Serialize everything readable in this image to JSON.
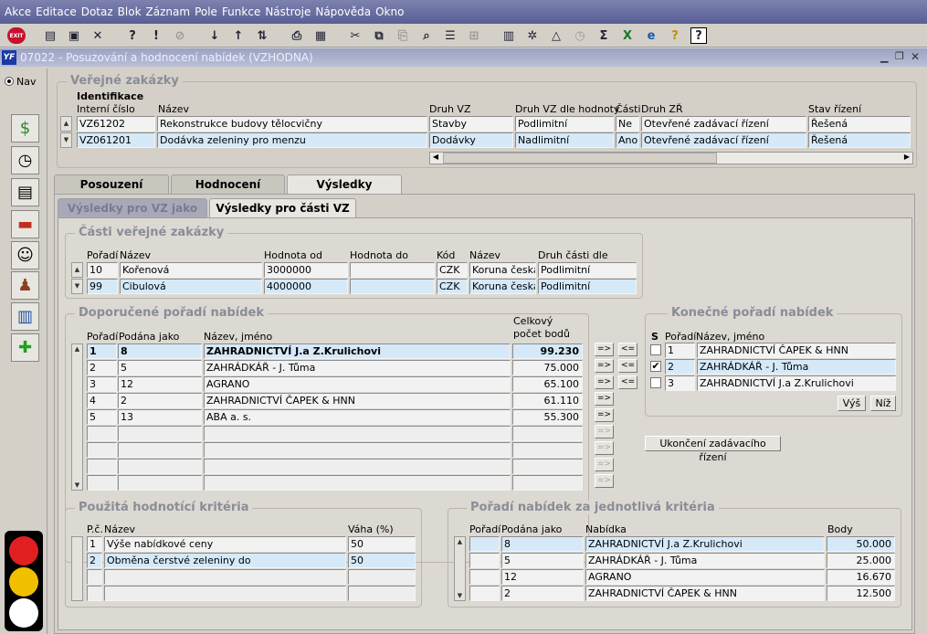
{
  "menu": [
    "Akce",
    "Editace",
    "Dotaz",
    "Blok",
    "Záznam",
    "Pole",
    "Funkce",
    "Nástroje",
    "Nápověda",
    "Okno"
  ],
  "toolbar": {
    "exit_label": "EXIT"
  },
  "window": {
    "title": "07022 - Posuzování a hodnocení nabídek (VZHODNA)",
    "app_icon": "YF"
  },
  "nav": {
    "label": "Nav"
  },
  "public": {
    "title": "Veřejné zakázky",
    "subtitle": "Identifikace",
    "headers": [
      "Interní číslo",
      "Název",
      "Druh VZ",
      "Druh VZ dle hodnoty",
      "Části",
      "Druh ZŘ",
      "Stav řízení"
    ],
    "rows": [
      [
        "VZ61202",
        "Rekonstrukce budovy tělocvičny",
        "Stavby",
        "Podlimitní",
        "Ne",
        "Otevřené zadávací řízení",
        "Řešená"
      ],
      [
        "VZ061201",
        "Dodávka zeleniny pro menzu",
        "Dodávky",
        "Nadlimitní",
        "Ano",
        "Otevřené zadávací řízení",
        "Řešená"
      ]
    ]
  },
  "tabs": [
    "Posouzení",
    "Hodnocení nabídek",
    "Výsledky hodnocení"
  ],
  "subtabs": [
    "Výsledky pro VZ jako celek",
    "Výsledky pro části VZ"
  ],
  "parts": {
    "title": "Části veřejné zakázky",
    "headers": [
      "Pořadí",
      "Název",
      "Hodnota od",
      "Hodnota do",
      "Kód",
      "Název",
      "Druh části dle hodnoty"
    ],
    "rows": [
      [
        "10",
        "Kořenová",
        "3000000",
        "",
        "CZK",
        "Koruna česká",
        "Podlimitní"
      ],
      [
        "99",
        "Cibulová",
        "4000000",
        "",
        "CZK",
        "Koruna česká",
        "Podlimitní"
      ]
    ]
  },
  "recommended": {
    "title": "Doporučené pořadí nabídek",
    "headers": [
      "Pořadí",
      "Podána jako",
      "Název, jméno",
      "Celkový",
      "počet bodů"
    ],
    "rows": [
      [
        "1",
        "8",
        "ZAHRADNICTVÍ J.a Z.Krulichovi",
        "99.230"
      ],
      [
        "2",
        "5",
        "ZAHRÁDKÁŘ - J. Tůma",
        "75.000"
      ],
      [
        "3",
        "12",
        "AGRANO",
        "65.100"
      ],
      [
        "4",
        "2",
        "ZAHRADNICTVÍ ČAPEK & HNN",
        "61.110"
      ],
      [
        "5",
        "13",
        "ABA  a. s.",
        "55.300"
      ]
    ]
  },
  "move_right": "=>",
  "move_left": "<=",
  "final": {
    "title": "Konečné pořadí nabídek",
    "headers": [
      "S",
      "Pořadí",
      "Název, jméno"
    ],
    "rows": [
      {
        "checked": false,
        "order": "1",
        "name": "ZAHRADNICTVÍ ČAPEK & HNN"
      },
      {
        "checked": true,
        "order": "2",
        "name": "ZAHRÁDKÁŘ - J. Tůma"
      },
      {
        "checked": false,
        "order": "3",
        "name": "ZAHRADNICTVÍ J.a Z.Krulichovi"
      }
    ],
    "up": "Výš",
    "down": "Níž",
    "finish": "Ukončení zadávacího řízení"
  },
  "criteria": {
    "title": "Použitá hodnotící kritéria",
    "headers": [
      "P.č.",
      "Název",
      "Váha (%)"
    ],
    "rows": [
      [
        "1",
        "Výše nabídkové ceny",
        "50"
      ],
      [
        "2",
        "Obměna čerstvé zeleniny do",
        "50"
      ]
    ]
  },
  "per_criteria": {
    "title": "Pořadí nabídek za jednotlivá kritéria",
    "headers": [
      "Pořadí",
      "Podána jako",
      "Nabídka",
      "Body"
    ],
    "rows": [
      [
        "",
        "8",
        "ZAHRADNICTVÍ J.a Z.Krulichovi",
        "50.000"
      ],
      [
        "",
        "5",
        "ZAHRÁDKÁŘ - J. Tůma",
        "25.000"
      ],
      [
        "",
        "12",
        "AGRANO",
        "16.670"
      ],
      [
        "",
        "2",
        "ZAHRADNICTVÍ ČAPEK & HNN",
        "12.500"
      ]
    ]
  },
  "colors": {
    "selected_row": "#d5e9f9",
    "menubar": "#585e96"
  }
}
